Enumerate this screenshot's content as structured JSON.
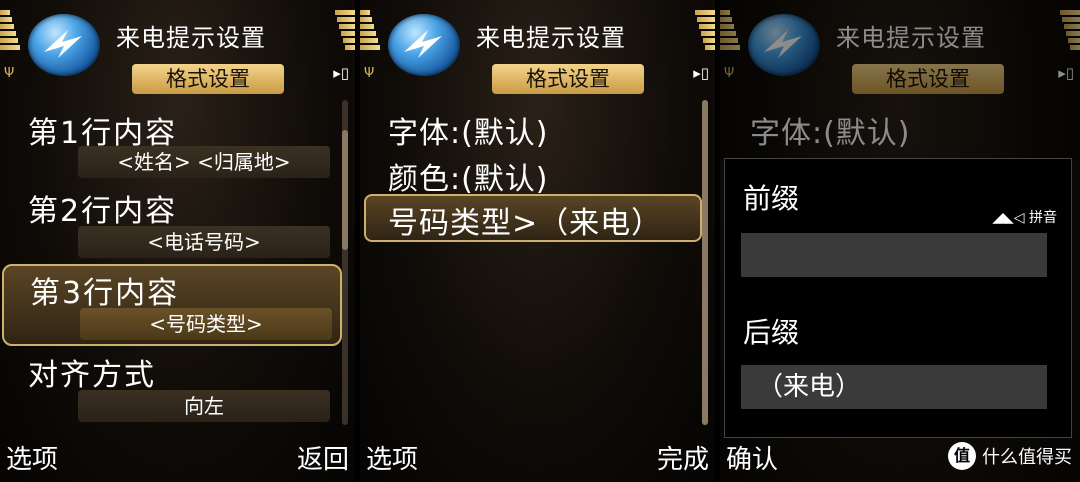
{
  "panels": [
    {
      "title": "来电提示设置",
      "tab": "格式设置",
      "items": [
        {
          "label": "第1行内容",
          "value": "<姓名> <归属地>"
        },
        {
          "label": "第2行内容",
          "value": "<电话号码>"
        },
        {
          "label": "第3行内容",
          "value": "<号码类型>"
        },
        {
          "label": "对齐方式",
          "value": "向左"
        }
      ],
      "softkeys": {
        "left": "选项",
        "right": "返回"
      }
    },
    {
      "title": "来电提示设置",
      "tab": "格式设置",
      "items": [
        {
          "label": "字体:(默认)"
        },
        {
          "label": "颜色:(默认)"
        },
        {
          "label": "号码类型>（来电）"
        }
      ],
      "softkeys": {
        "left": "选项",
        "right": "完成"
      }
    },
    {
      "title": "来电提示设置",
      "tab": "格式设置",
      "background_item": "字体:(默认)",
      "dialog": {
        "prefix_label": "前缀",
        "prefix_value": "",
        "ime_indicator": "拼音",
        "suffix_label": "后缀",
        "suffix_value": "（来电）"
      },
      "softkeys": {
        "left": "确认"
      }
    }
  ],
  "watermark": {
    "badge": "值",
    "text": "什么值得买"
  },
  "colors": {
    "tab_gold": "#e0b868",
    "selection_border": "#cdb06a",
    "icon_blue": "#4aa3e6"
  }
}
